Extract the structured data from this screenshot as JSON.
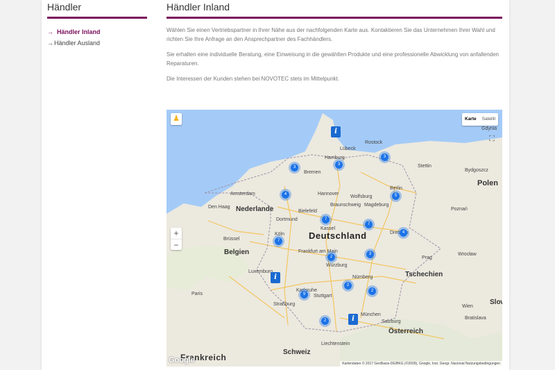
{
  "sidebar": {
    "title": "Händler",
    "items": [
      {
        "label": "Händler Inland",
        "arrow": "→"
      },
      {
        "label": "Händler Ausland",
        "arrow": "→"
      }
    ]
  },
  "main": {
    "title": "Händler Inland",
    "paragraphs": [
      "Wählen Sie einen Vertriebspartner in Ihrer Nähe aus der nachfolgenden Karte aus. Kontaktieren Sie das Unternehmen Ihrer Wahl und richten Sie Ihre Anfrage an den Ansprechpartner des Fachhändlers.",
      "Sie erhalten eine individuelle Beratung, eine Einweisung in die gewählten Produkte und eine professionelle Abwicklung von anfallenden Reparaturen.",
      "Die Interessen der Kunden stehen bei NOVOTEC stets im Mittelpunkt."
    ]
  },
  "map": {
    "pegman": "♟",
    "type_map": "Karte",
    "type_satellite": "Satellit",
    "fullscreen": "⛶",
    "zoom_in": "+",
    "zoom_out": "−",
    "google": "Google",
    "copyright": "Kartendaten © 2017 GeoBasis-DE/BKG (©2009), Google, Inst. Geogr. Nacional   Nutzungsbedingungen",
    "labels": [
      {
        "text": "Deutschland",
        "size": 13,
        "bold": true
      },
      {
        "text": "Nederlande",
        "size": 10,
        "bold": true
      },
      {
        "text": "Belgien",
        "size": 10,
        "bold": true
      },
      {
        "text": "Luxemburg",
        "size": 7
      },
      {
        "text": "Tschechien",
        "size": 10,
        "bold": true
      },
      {
        "text": "Österreich",
        "size": 10,
        "bold": true
      },
      {
        "text": "Schweiz",
        "size": 10,
        "bold": true
      },
      {
        "text": "Frankreich",
        "size": 12,
        "bold": true
      },
      {
        "text": "Liechtenstein",
        "size": 7
      },
      {
        "text": "Polen",
        "size": 11,
        "bold": true
      },
      {
        "text": "Hamburg",
        "size": 7
      },
      {
        "text": "Bremen",
        "size": 7
      },
      {
        "text": "Berlin",
        "size": 7
      },
      {
        "text": "Hannover",
        "size": 7
      },
      {
        "text": "Wolfsburg",
        "size": 7
      },
      {
        "text": "Braunschweig",
        "size": 7
      },
      {
        "text": "Magdeburg",
        "size": 7
      },
      {
        "text": "Dortmund",
        "size": 7
      },
      {
        "text": "Köln",
        "size": 7
      },
      {
        "text": "Frankfurt am Main",
        "size": 7
      },
      {
        "text": "Nürnberg",
        "size": 7
      },
      {
        "text": "Stuttgart",
        "size": 7
      },
      {
        "text": "Karlsruhe",
        "size": 7
      },
      {
        "text": "Straßburg",
        "size": 7
      },
      {
        "text": "München",
        "size": 7
      },
      {
        "text": "Salzburg",
        "size": 7
      },
      {
        "text": "Rostock",
        "size": 7
      },
      {
        "text": "Lübeck",
        "size": 7
      },
      {
        "text": "Stettin",
        "size": 7
      },
      {
        "text": "Gdynia",
        "size": 7
      },
      {
        "text": "Bydgoszcz",
        "size": 7
      },
      {
        "text": "Poznań",
        "size": 7
      },
      {
        "text": "Wrocław",
        "size": 7
      },
      {
        "text": "Prag",
        "size": 7
      },
      {
        "text": "Brüssel",
        "size": 7
      },
      {
        "text": "Amsterdam",
        "size": 7
      },
      {
        "text": "Den Haag",
        "size": 7
      },
      {
        "text": "Paris",
        "size": 7
      },
      {
        "text": "Wien",
        "size": 7
      },
      {
        "text": "Bratislava",
        "size": 7
      },
      {
        "text": "Kassel",
        "size": 7
      },
      {
        "text": "Dresden",
        "size": 7
      },
      {
        "text": "Bielefeld",
        "size": 7
      },
      {
        "text": "Würzburg",
        "size": 7
      },
      {
        "text": "Slow",
        "size": 10,
        "bold": true
      }
    ],
    "clusters": [
      "3",
      "3",
      "3",
      "4",
      "5",
      "7",
      "7",
      "7",
      "4",
      "7",
      "2",
      "3",
      "2",
      "2",
      "9",
      "2"
    ],
    "info_markers": [
      "i",
      "i",
      "i"
    ],
    "colors": {
      "accent": "#7a0f5c",
      "cluster": "#1b73e8",
      "water": "#a4cbf7",
      "land": "#ece9df"
    }
  }
}
